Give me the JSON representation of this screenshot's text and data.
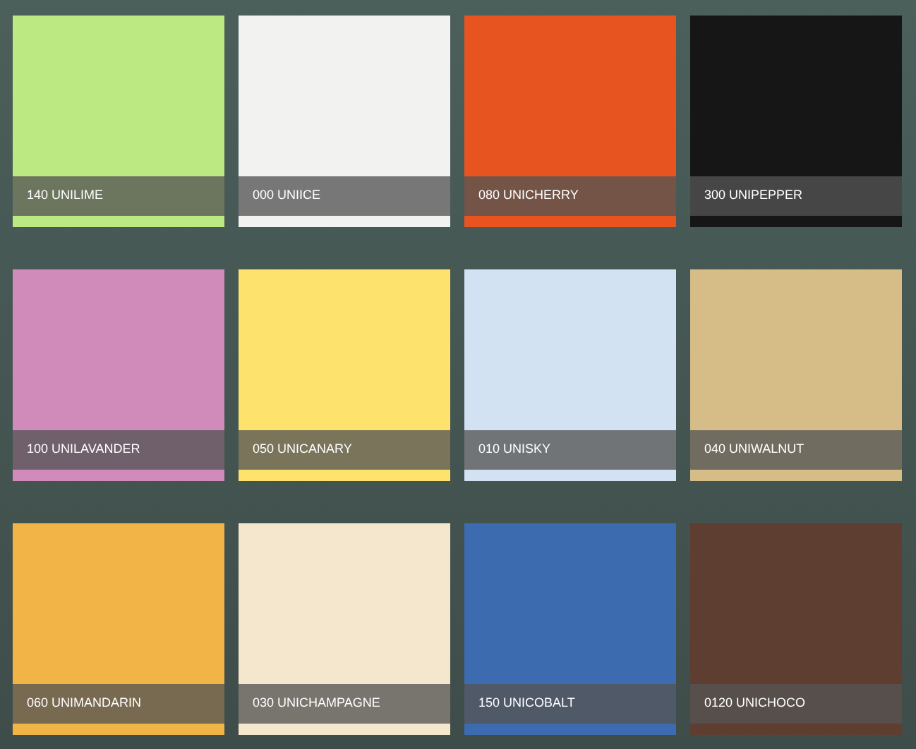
{
  "swatches": [
    {
      "label": "140 UNILIME",
      "color": "#bde982"
    },
    {
      "label": "000 UNIICE",
      "color": "#f2f2f0"
    },
    {
      "label": "080 UNICHERRY",
      "color": "#e8541f"
    },
    {
      "label": "300 UNIPEPPER",
      "color": "#161616"
    },
    {
      "label": "100 UNILAVANDER",
      "color": "#d08bbb"
    },
    {
      "label": "050 UNICANARY",
      "color": "#fde36d"
    },
    {
      "label": "010 UNISKY",
      "color": "#d2e2f2"
    },
    {
      "label": "040 UNIWALNUT",
      "color": "#d6bd88"
    },
    {
      "label": "060 UNIMANDARIN",
      "color": "#f3b447"
    },
    {
      "label": "030 UNICHAMPAGNE",
      "color": "#f5e6ce"
    },
    {
      "label": "150 UNICOBALT",
      "color": "#3c6baf"
    },
    {
      "label": "0120 UNICHOCO",
      "color": "#5d3e30"
    }
  ]
}
